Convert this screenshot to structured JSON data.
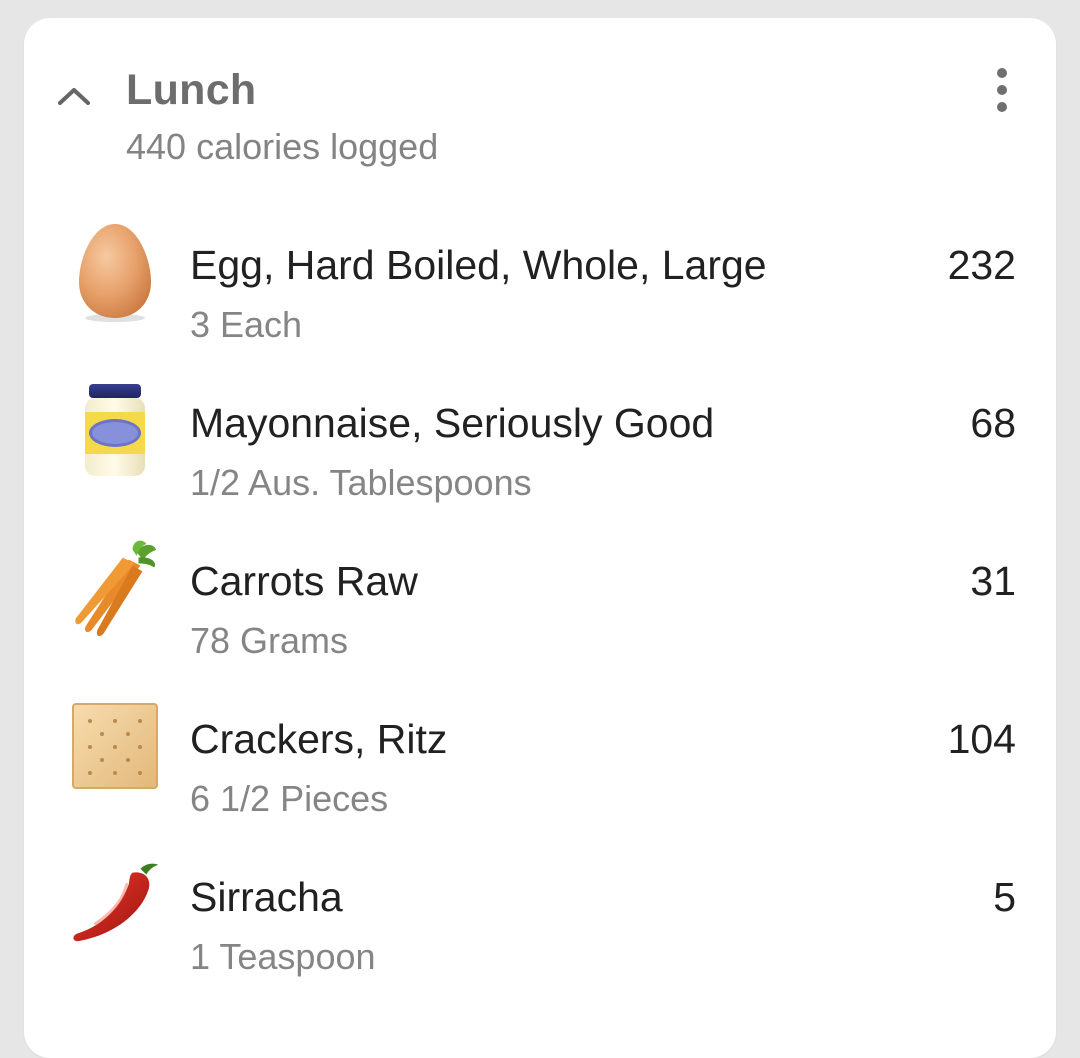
{
  "meal": {
    "title": "Lunch",
    "subtitle": "440 calories logged"
  },
  "items": [
    {
      "name": "Egg, Hard Boiled, Whole, Large",
      "quantity": "3 Each",
      "calories": "232",
      "icon": "egg-icon"
    },
    {
      "name": "Mayonnaise, Seriously Good",
      "quantity": "1/2 Aus. Tablespoons",
      "calories": "68",
      "icon": "mayonnaise-jar-icon"
    },
    {
      "name": "Carrots Raw",
      "quantity": "78 Grams",
      "calories": "31",
      "icon": "carrot-icon"
    },
    {
      "name": "Crackers, Ritz",
      "quantity": "6 1/2 Pieces",
      "calories": "104",
      "icon": "cracker-icon"
    },
    {
      "name": "Sirracha",
      "quantity": "1 Teaspoon",
      "calories": "5",
      "icon": "chili-pepper-icon"
    }
  ],
  "colors": {
    "background": "#e6e6e6",
    "card": "#ffffff",
    "title": "#6d6d6d",
    "secondary_text": "#858585",
    "primary_text": "#212121"
  }
}
